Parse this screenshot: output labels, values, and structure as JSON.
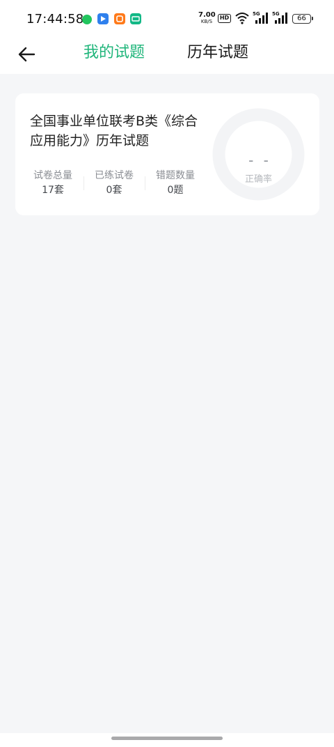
{
  "status_bar": {
    "time": "17:44:58",
    "net_speed_value": "7.00",
    "net_speed_unit": "KB/S",
    "hd_badge": "HD",
    "network_1": "5G",
    "network_2": "5G",
    "battery": "66",
    "app_icons": [
      "chat-app-icon",
      "navigation-app-icon",
      "video-app-icon",
      "ticket-app-icon"
    ]
  },
  "header": {
    "tabs": [
      {
        "label": "我的试题",
        "active": true
      },
      {
        "label": "历年试题",
        "active": false
      }
    ]
  },
  "card": {
    "title": "全国事业单位联考B类《综合应用能力》历年试题",
    "stats": [
      {
        "label": "试卷总量",
        "value": "17套"
      },
      {
        "label": "已练试卷",
        "value": "0套"
      },
      {
        "label": "错题数量",
        "value": "0题"
      }
    ],
    "accuracy_value": "- -",
    "accuracy_label": "正确率"
  },
  "colors": {
    "accent": "#1fb57a",
    "background": "#f5f6f8",
    "ring": "#f3f4f6"
  }
}
